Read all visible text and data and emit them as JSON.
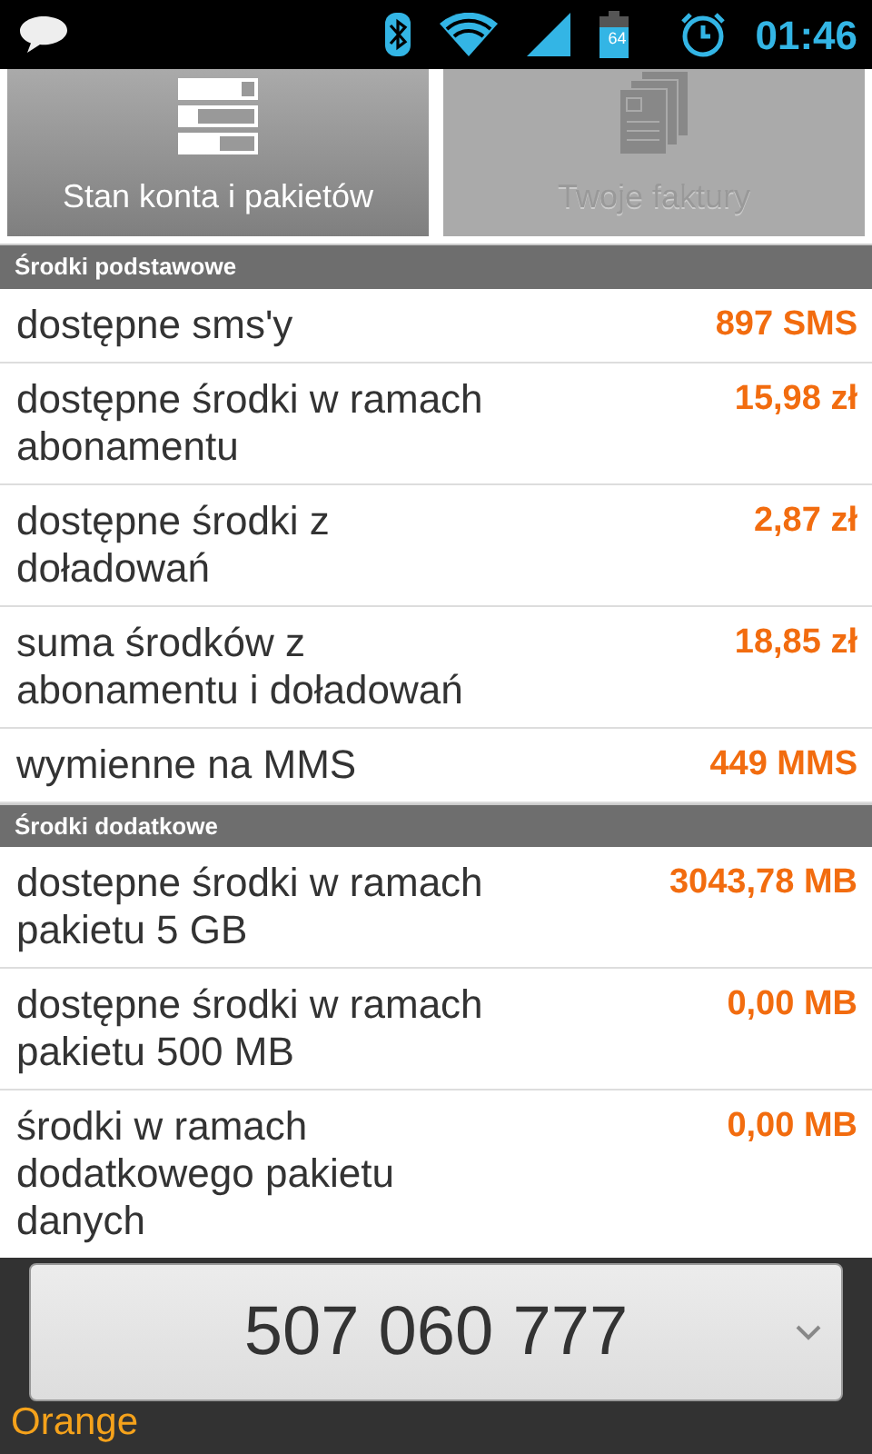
{
  "status_bar": {
    "battery": "64",
    "time": "01:46"
  },
  "tabs": [
    {
      "label": "Stan konta i pakietów",
      "selected": true,
      "kind": "account"
    },
    {
      "label": "Twoje faktury",
      "selected": false,
      "kind": "invoices"
    }
  ],
  "sections": [
    {
      "title": "Środki podstawowe",
      "rows": [
        {
          "label": "dostępne sms'y",
          "value": "897 SMS"
        },
        {
          "label": "dostępne środki w ramach abonamentu",
          "value": "15,98 zł"
        },
        {
          "label": "dostępne środki z doładowań",
          "value": "2,87 zł"
        },
        {
          "label": "suma środków z abonamentu i doładowań",
          "value": "18,85 zł"
        },
        {
          "label": "wymienne na MMS",
          "value": "449 MMS"
        }
      ]
    },
    {
      "title": "Środki dodatkowe",
      "rows": [
        {
          "label": "dostepne środki w ramach pakietu 5 GB",
          "value": "3043,78 MB"
        },
        {
          "label": "dostępne środki w ramach pakietu 500 MB",
          "value": "0,00 MB"
        },
        {
          "label": "środki w ramach dodatkowego pakietu danych",
          "value": "0,00 MB"
        }
      ]
    }
  ],
  "number_selector": {
    "value": "507 060 777"
  },
  "operator": "Orange"
}
